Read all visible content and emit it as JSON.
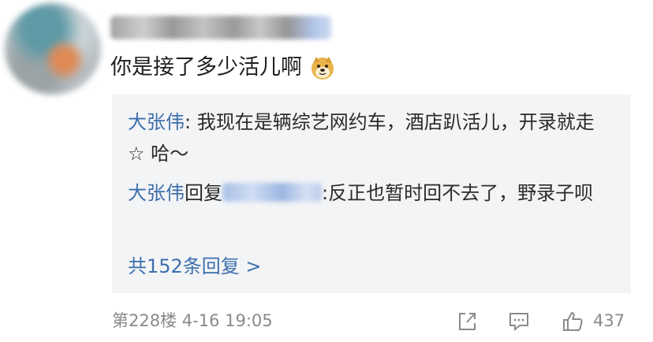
{
  "comment": {
    "text": "你是接了多少活儿啊",
    "emoji": "doge-emoji"
  },
  "replies": [
    {
      "author": "大张伟",
      "text": ": 我现在是辆综艺网约车，酒店趴活儿，开录就走 ☆ 哈～"
    },
    {
      "author": "大张伟",
      "connector": "回复",
      "text": ":反正也暂时回不去了，野录子呗"
    }
  ],
  "more_replies_label": "共152条回复 >",
  "meta": {
    "floor_time": "第228楼  4-16 19:05"
  },
  "actions": {
    "like_count": "437"
  },
  "colors": {
    "link_blue": "#3d6fad",
    "reply_bg": "#f3f4f6",
    "meta_gray": "#8a8a8a"
  }
}
